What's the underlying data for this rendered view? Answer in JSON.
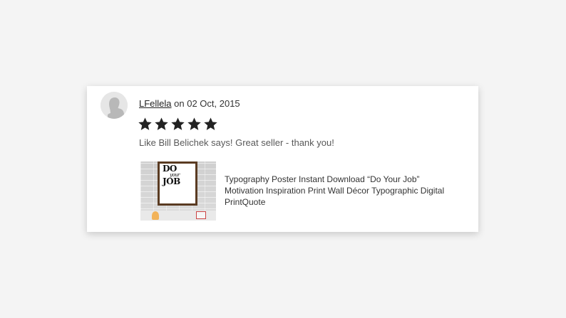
{
  "review": {
    "reviewer_name": "LFellela",
    "date_text": "on 02 Oct, 2015",
    "rating": 5,
    "rating_max": 5,
    "text": "Like Bill Belichek says! Great seller - thank you!"
  },
  "listing": {
    "title": "Typography Poster Instant Download “Do Your Job” Motivation Inspiration Print Wall Décor Typographic Digital PrintQuote",
    "thumbnail_text_top": "DO",
    "thumbnail_text_mid": "your",
    "thumbnail_text_bottom": "JOB"
  },
  "colors": {
    "star": "#222222",
    "background": "#f4f4f4",
    "card": "#ffffff"
  },
  "icons": {
    "avatar": "default-user-avatar-icon",
    "star": "filled-star-icon"
  }
}
